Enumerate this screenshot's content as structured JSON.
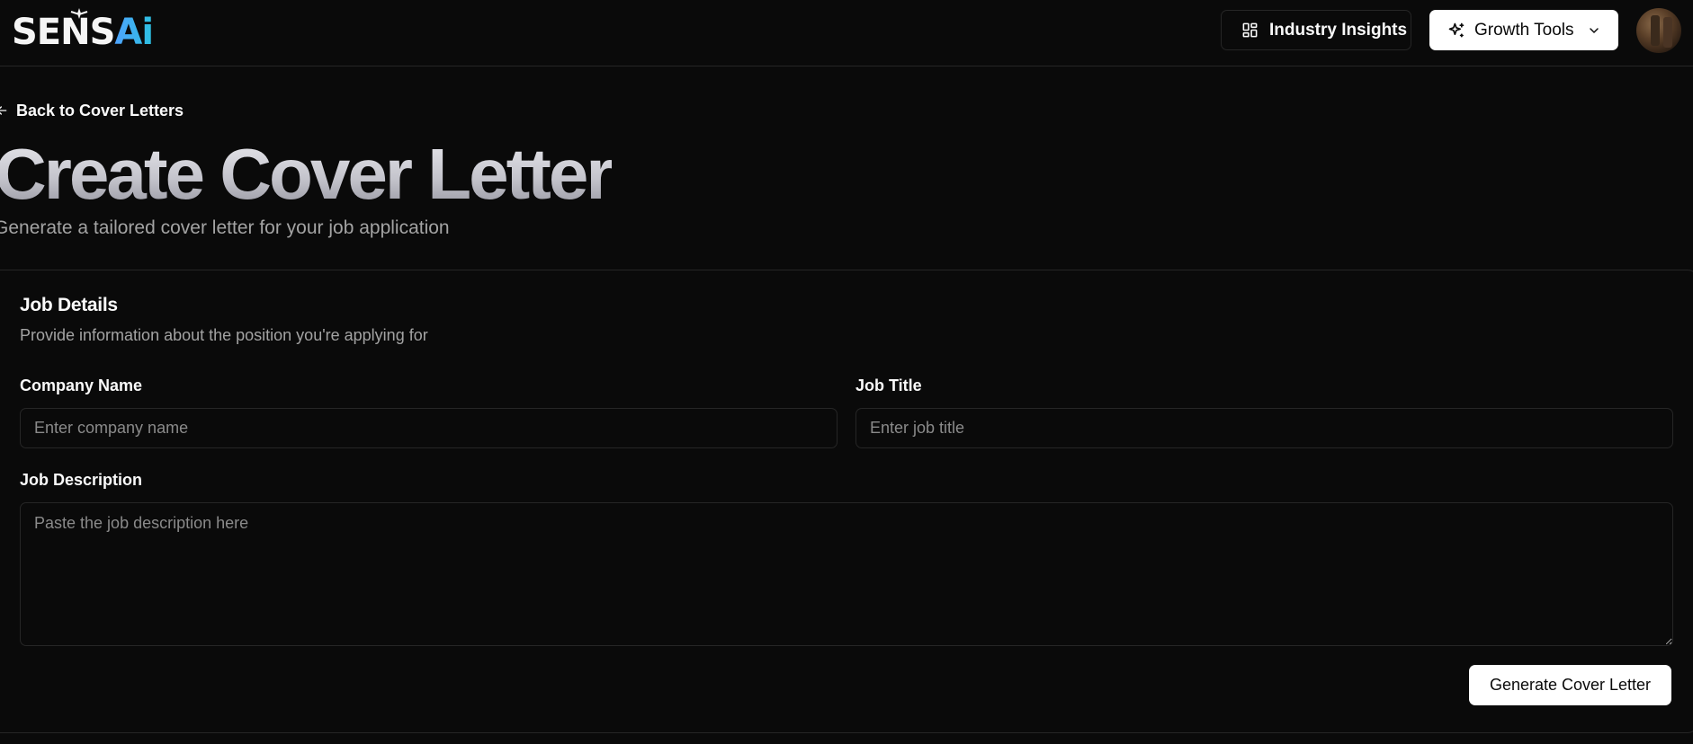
{
  "app": {
    "logo_part1": "SENS",
    "logo_part2": "Ai",
    "accent_color": "#3b9cf0"
  },
  "header": {
    "insights_label": "Industry Insights",
    "insights_icon": "layout-dashboard-icon",
    "growth_label": "Growth Tools",
    "growth_icon": "sparkles-icon",
    "growth_chevron": "chevron-down-icon"
  },
  "page": {
    "back_label": "Back to Cover Letters",
    "title": "Create Cover Letter",
    "subtitle": "Generate a tailored cover letter for your job application"
  },
  "form": {
    "title": "Job Details",
    "description": "Provide information about the position you're applying for",
    "company_label": "Company Name",
    "company_placeholder": "Enter company name",
    "company_value": "",
    "job_title_label": "Job Title",
    "job_title_placeholder": "Enter job title",
    "job_title_value": "",
    "job_desc_label": "Job Description",
    "job_desc_placeholder": "Paste the job description here",
    "job_desc_value": "",
    "submit_label": "Generate Cover Letter"
  }
}
